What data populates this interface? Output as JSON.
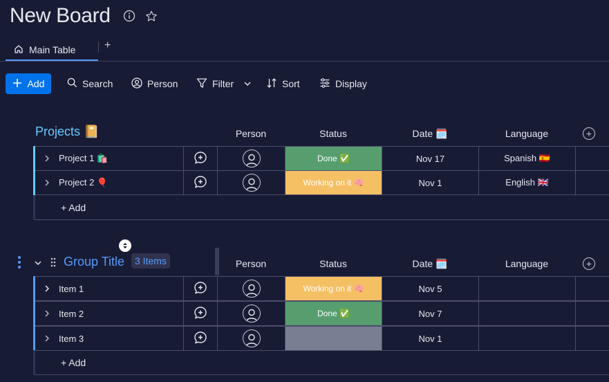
{
  "board": {
    "title": "New Board"
  },
  "tabs": [
    {
      "label": "Main Table"
    }
  ],
  "toolbar": {
    "add_label": "Add",
    "search_label": "Search",
    "person_label": "Person",
    "filter_label": "Filter",
    "sort_label": "Sort",
    "display_label": "Display"
  },
  "columns": {
    "person": "Person",
    "status": "Status",
    "date": "Date 🗓️",
    "language": "Language"
  },
  "colors": {
    "accent": "#579bfc",
    "done": "#579e6f",
    "working": "#f5bf64",
    "empty": "#797e93",
    "background": "#181b34"
  },
  "groups": [
    {
      "title": "Projects 📔",
      "color": "#66ccff",
      "add_item_label": "+ Add",
      "items": [
        {
          "name": "Project 1 🛍️",
          "status": "Done ✅",
          "status_color": "#579e6f",
          "date": "Nov 17",
          "language": "Spanish 🇪🇸"
        },
        {
          "name": "Project 2 🎈",
          "status": "Working on it 🧠",
          "status_color": "#f5bf64",
          "date": "Nov 1",
          "language": "English 🇬🇧"
        }
      ]
    },
    {
      "title": "Group Title",
      "count_badge": "3 Items",
      "color": "#579bfc",
      "add_item_label": "+ Add",
      "items": [
        {
          "name": "Item 1",
          "status": "Working on it 🧠",
          "status_color": "#f5bf64",
          "date": "Nov 5",
          "language": ""
        },
        {
          "name": "Item 2",
          "status": "Done ✅",
          "status_color": "#579e6f",
          "date": "Nov 7",
          "language": ""
        },
        {
          "name": "Item 3",
          "status": "",
          "status_color": "#797e93",
          "date": "Nov 1",
          "language": ""
        }
      ]
    }
  ]
}
